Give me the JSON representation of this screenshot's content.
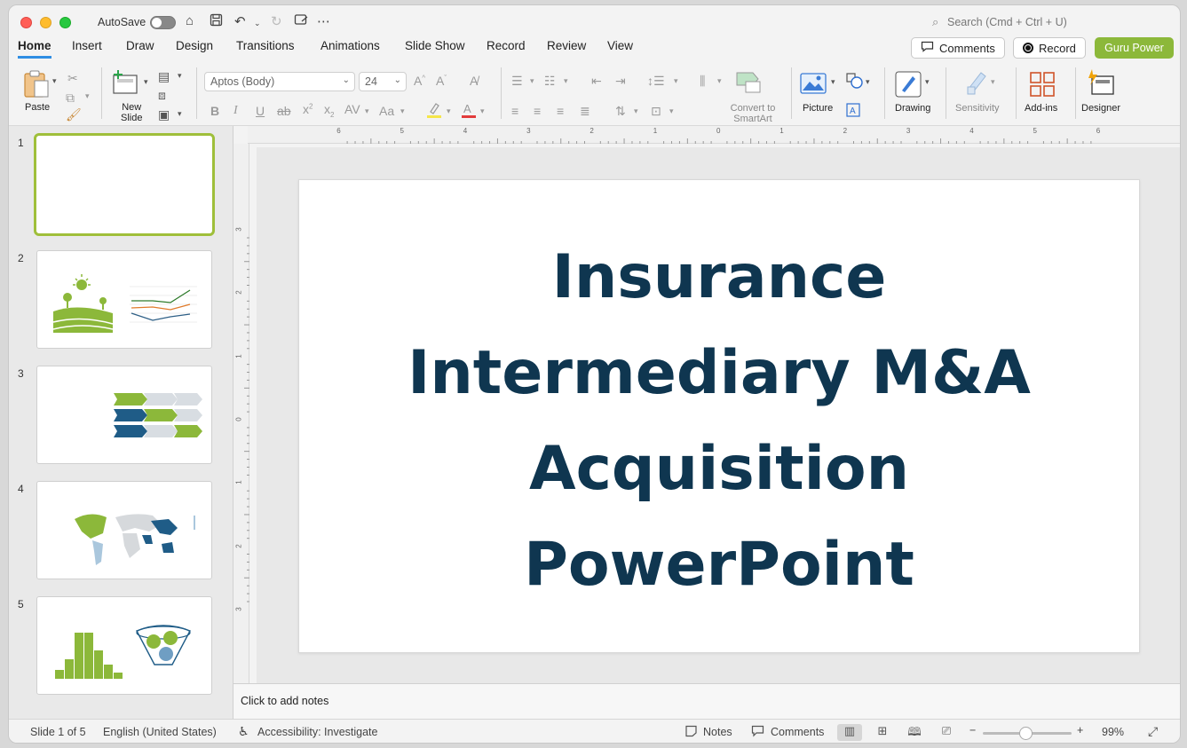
{
  "titlebar": {
    "autosave_label": "AutoSave",
    "search_placeholder": "Search (Cmd + Ctrl + U)"
  },
  "tabs": [
    "Home",
    "Insert",
    "Draw",
    "Design",
    "Transitions",
    "Animations",
    "Slide Show",
    "Record",
    "Review",
    "View"
  ],
  "active_tab": "Home",
  "top_buttons": {
    "comments": "Comments",
    "record": "Record",
    "guru": "Guru Power"
  },
  "ribbon": {
    "paste": "Paste",
    "new_slide_1": "New",
    "new_slide_2": "Slide",
    "font_name": "Aptos (Body)",
    "font_size": "24",
    "convert_1": "Convert to",
    "convert_2": "SmartArt",
    "picture": "Picture",
    "drawing": "Drawing",
    "sensitivity": "Sensitivity",
    "addins": "Add-ins",
    "designer": "Designer"
  },
  "ruler": {
    "h": [
      "6",
      "5",
      "4",
      "3",
      "2",
      "1",
      "0",
      "1",
      "2",
      "3",
      "4",
      "5",
      "6"
    ],
    "v": [
      "3",
      "2",
      "1",
      "0",
      "1",
      "2",
      "3"
    ]
  },
  "thumbnails": [
    {
      "num": "1"
    },
    {
      "num": "2"
    },
    {
      "num": "3"
    },
    {
      "num": "4"
    },
    {
      "num": "5"
    }
  ],
  "slide": {
    "title_lines": [
      "Insurance",
      "Intermediary M&A",
      "Acquisition",
      "PowerPoint"
    ]
  },
  "notes": {
    "placeholder": "Click to add notes"
  },
  "status": {
    "slide_info": "Slide 1 of 5",
    "language": "English (United States)",
    "accessibility": "Accessibility: Investigate",
    "notes": "Notes",
    "comments": "Comments",
    "zoom": "99%"
  },
  "colors": {
    "accent_green": "#8cb83a",
    "title_navy": "#0f3650",
    "tab_underline": "#2f8ee3"
  }
}
